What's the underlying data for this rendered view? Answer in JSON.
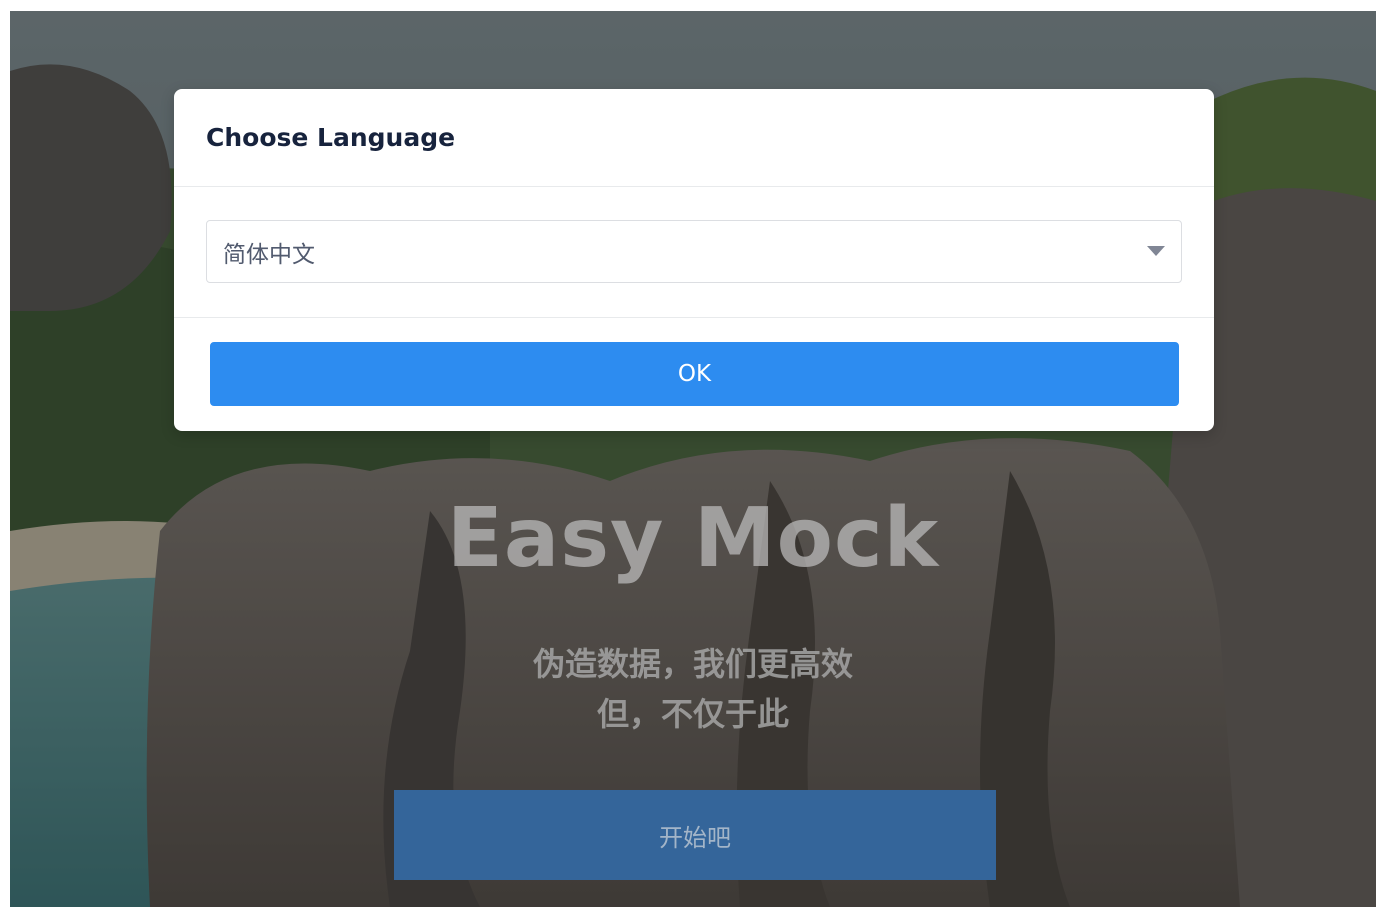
{
  "modal": {
    "title": "Choose Language",
    "language_select": {
      "selected": "简体中文"
    },
    "ok_label": "OK"
  },
  "hero": {
    "title": "Easy Mock",
    "subtitle_line1": "伪造数据，我们更高效",
    "subtitle_line2": "但，不仅于此",
    "start_label": "开始吧"
  },
  "colors": {
    "primary": "#2d8cf0",
    "start_button": "#34659a",
    "title_text": "#17233d"
  },
  "icons": {
    "select_arrow": "caret-down-icon"
  }
}
